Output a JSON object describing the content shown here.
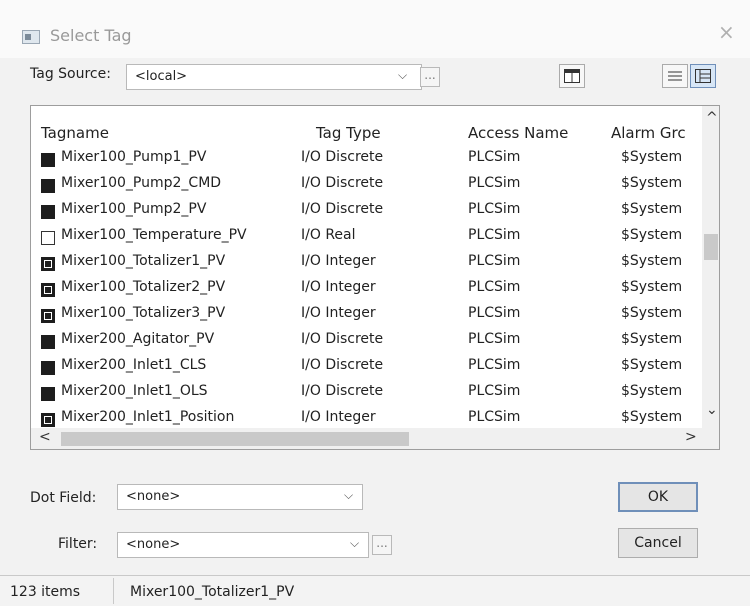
{
  "window": {
    "title": "Select Tag",
    "close_glyph": "×"
  },
  "tag_source": {
    "label": "Tag Source:",
    "value": "<local>",
    "chevron": "⌵",
    "browse": "..."
  },
  "table": {
    "columns": [
      "Tagname",
      "Tag Type",
      "Access Name",
      "Alarm Grc"
    ],
    "rows": [
      {
        "icon": "discrete",
        "tagname": "Mixer100_Pump1_PV",
        "type": "I/O Discrete",
        "access": "PLCSim",
        "alarm": "$System"
      },
      {
        "icon": "discrete",
        "tagname": "Mixer100_Pump2_CMD",
        "type": "I/O Discrete",
        "access": "PLCSim",
        "alarm": "$System"
      },
      {
        "icon": "discrete",
        "tagname": "Mixer100_Pump2_PV",
        "type": "I/O Discrete",
        "access": "PLCSim",
        "alarm": "$System"
      },
      {
        "icon": "real",
        "tagname": "Mixer100_Temperature_PV",
        "type": "I/O Real",
        "access": "PLCSim",
        "alarm": "$System"
      },
      {
        "icon": "integer",
        "tagname": "Mixer100_Totalizer1_PV",
        "type": "I/O Integer",
        "access": "PLCSim",
        "alarm": "$System"
      },
      {
        "icon": "integer",
        "tagname": "Mixer100_Totalizer2_PV",
        "type": "I/O Integer",
        "access": "PLCSim",
        "alarm": "$System"
      },
      {
        "icon": "integer",
        "tagname": "Mixer100_Totalizer3_PV",
        "type": "I/O Integer",
        "access": "PLCSim",
        "alarm": "$System"
      },
      {
        "icon": "discrete",
        "tagname": "Mixer200_Agitator_PV",
        "type": "I/O Discrete",
        "access": "PLCSim",
        "alarm": "$System"
      },
      {
        "icon": "discrete",
        "tagname": "Mixer200_Inlet1_CLS",
        "type": "I/O Discrete",
        "access": "PLCSim",
        "alarm": "$System"
      },
      {
        "icon": "discrete",
        "tagname": "Mixer200_Inlet1_OLS",
        "type": "I/O Discrete",
        "access": "PLCSim",
        "alarm": "$System"
      },
      {
        "icon": "integer",
        "tagname": "Mixer200_Inlet1_Position",
        "type": "I/O Integer",
        "access": "PLCSim",
        "alarm": "$System"
      }
    ],
    "scroll_up": "^",
    "scroll_down": "⌄",
    "scroll_left": "<",
    "scroll_right": ">"
  },
  "dot_field": {
    "label": "Dot Field:",
    "value": "<none>",
    "chevron": "⌵"
  },
  "filter": {
    "label": "Filter:",
    "value": "<none>",
    "chevron": "⌵",
    "browse": "..."
  },
  "buttons": {
    "ok": "OK",
    "cancel": "Cancel"
  },
  "status": {
    "count": "123 items",
    "selected": "Mixer100_Totalizer1_PV"
  }
}
